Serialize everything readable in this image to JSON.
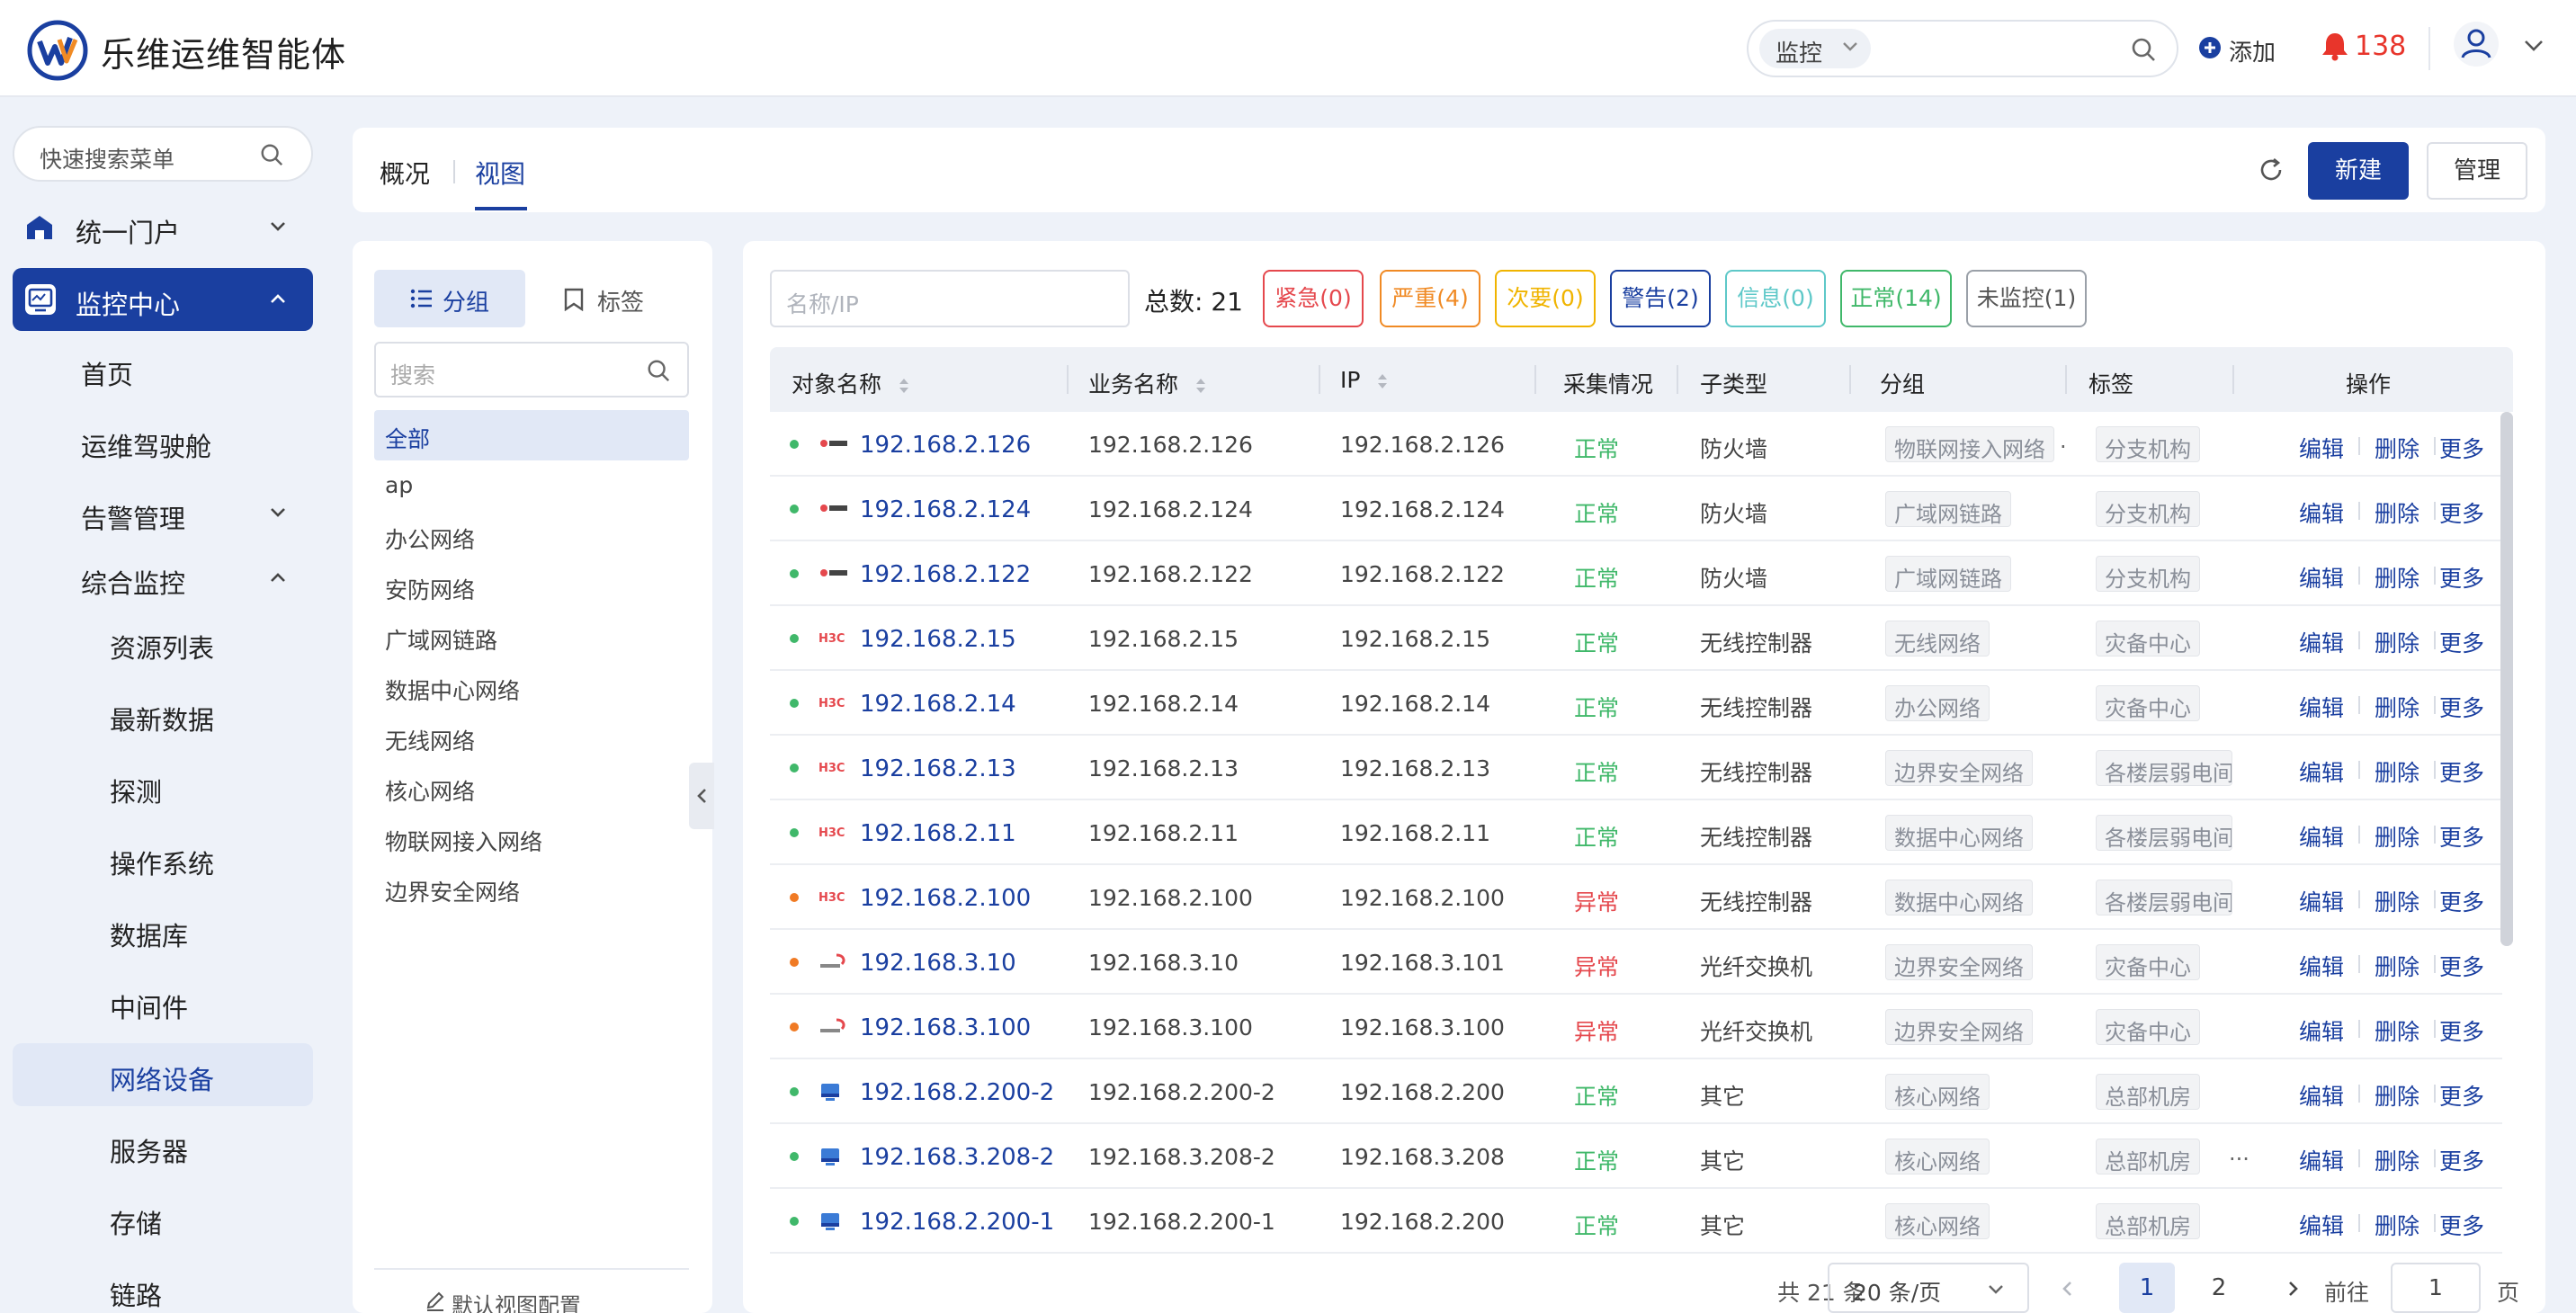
{
  "header": {
    "app_title": "乐维运维智能体",
    "search_scope": "监控",
    "add_label": "添加",
    "alert_count": "138"
  },
  "sidebar": {
    "search_placeholder": "快速搜索菜单",
    "portal": "统一门户",
    "monitor_center": "监控中心",
    "home": "首页",
    "cockpit": "运维驾驶舱",
    "alert_mgmt": "告警管理",
    "integrated": "综合监控",
    "resources": "资源列表",
    "latest": "最新数据",
    "probe": "探测",
    "os": "操作系统",
    "db": "数据库",
    "middleware": "中间件",
    "netdev": "网络设备",
    "server": "服务器",
    "storage": "存储",
    "link": "链路"
  },
  "top": {
    "tab_overview": "概况",
    "tab_view": "视图",
    "new_label": "新建",
    "manage_label": "管理"
  },
  "groups": {
    "tab_group": "分组",
    "tab_tag": "标签",
    "search_placeholder": "搜索",
    "items": [
      "全部",
      "ap",
      "办公网络",
      "安防网络",
      "广域网链路",
      "数据中心网络",
      "无线网络",
      "核心网络",
      "物联网接入网络",
      "边界安全网络"
    ],
    "footer": "默认视图配置"
  },
  "filter": {
    "placeholder": "名称/IP",
    "total_label": "总数:",
    "total": "21",
    "badges": {
      "urgent": "紧急(0)",
      "severe": "严重(4)",
      "minor": "次要(0)",
      "warning": "警告(2)",
      "info": "信息(0)",
      "normal": "正常(14)",
      "unmonitored": "未监控(1)"
    },
    "colors": {
      "urgent": "#e5484d",
      "severe": "#f08a24",
      "minor": "#f0b400",
      "warning": "#1a3fa0",
      "info": "#5ec8c8",
      "normal": "#40b86a",
      "unmonitored": "#9aa0a8"
    }
  },
  "table": {
    "columns": {
      "name": "对象名称",
      "biz": "业务名称",
      "ip": "IP",
      "collect": "采集情况",
      "subtype": "子类型",
      "group": "分组",
      "tag": "标签",
      "ops": "操作"
    },
    "actions": {
      "edit": "编辑",
      "delete": "删除",
      "more": "更多"
    },
    "rows": [
      {
        "vendor": "firewall-logo",
        "status": "ok",
        "name": "192.168.2.126",
        "biz": "192.168.2.126",
        "ip": "192.168.2.126",
        "collect": "正常",
        "subtype": "防火墙",
        "group": "物联网接入网络",
        "group_more": true,
        "tag": "分支机构",
        "tag_more": false
      },
      {
        "vendor": "firewall-logo",
        "status": "ok",
        "name": "192.168.2.124",
        "biz": "192.168.2.124",
        "ip": "192.168.2.124",
        "collect": "正常",
        "subtype": "防火墙",
        "group": "广域网链路",
        "group_more": false,
        "tag": "分支机构",
        "tag_more": false
      },
      {
        "vendor": "firewall-logo",
        "status": "ok",
        "name": "192.168.2.122",
        "biz": "192.168.2.122",
        "ip": "192.168.2.122",
        "collect": "正常",
        "subtype": "防火墙",
        "group": "广域网链路",
        "group_more": false,
        "tag": "分支机构",
        "tag_more": false
      },
      {
        "vendor": "h3c-logo",
        "status": "ok",
        "name": "192.168.2.15",
        "biz": "192.168.2.15",
        "ip": "192.168.2.15",
        "collect": "正常",
        "subtype": "无线控制器",
        "group": "无线网络",
        "group_more": false,
        "tag": "灾备中心",
        "tag_more": false
      },
      {
        "vendor": "h3c-logo",
        "status": "ok",
        "name": "192.168.2.14",
        "biz": "192.168.2.14",
        "ip": "192.168.2.14",
        "collect": "正常",
        "subtype": "无线控制器",
        "group": "办公网络",
        "group_more": false,
        "tag": "灾备中心",
        "tag_more": false
      },
      {
        "vendor": "h3c-logo",
        "status": "ok",
        "name": "192.168.2.13",
        "biz": "192.168.2.13",
        "ip": "192.168.2.13",
        "collect": "正常",
        "subtype": "无线控制器",
        "group": "边界安全网络",
        "group_more": false,
        "tag": "各楼层弱电间",
        "tag_more": false
      },
      {
        "vendor": "h3c-logo",
        "status": "ok",
        "name": "192.168.2.11",
        "biz": "192.168.2.11",
        "ip": "192.168.2.11",
        "collect": "正常",
        "subtype": "无线控制器",
        "group": "数据中心网络",
        "group_more": false,
        "tag": "各楼层弱电间",
        "tag_more": false
      },
      {
        "vendor": "h3c-logo",
        "status": "err",
        "name": "192.168.2.100",
        "biz": "192.168.2.100",
        "ip": "192.168.2.100",
        "collect": "异常",
        "subtype": "无线控制器",
        "group": "数据中心网络",
        "group_more": false,
        "tag": "各楼层弱电间",
        "tag_more": false
      },
      {
        "vendor": "brocade-logo",
        "status": "err",
        "name": "192.168.3.10",
        "biz": "192.168.3.10",
        "ip": "192.168.3.101",
        "collect": "异常",
        "subtype": "光纤交换机",
        "group": "边界安全网络",
        "group_more": false,
        "tag": "灾备中心",
        "tag_more": false
      },
      {
        "vendor": "brocade-logo",
        "status": "err",
        "name": "192.168.3.100",
        "biz": "192.168.3.100",
        "ip": "192.168.3.100",
        "collect": "异常",
        "subtype": "光纤交换机",
        "group": "边界安全网络",
        "group_more": false,
        "tag": "灾备中心",
        "tag_more": false
      },
      {
        "vendor": "device-icon",
        "status": "ok",
        "name": "192.168.2.200-2",
        "biz": "192.168.2.200-2",
        "ip": "192.168.2.200",
        "collect": "正常",
        "subtype": "其它",
        "group": "核心网络",
        "group_more": false,
        "tag": "总部机房",
        "tag_more": false
      },
      {
        "vendor": "device-icon",
        "status": "ok",
        "name": "192.168.3.208-2",
        "biz": "192.168.3.208-2",
        "ip": "192.168.3.208",
        "collect": "正常",
        "subtype": "其它",
        "group": "核心网络",
        "group_more": false,
        "tag": "总部机房",
        "tag_more": true
      },
      {
        "vendor": "device-icon",
        "status": "ok",
        "name": "192.168.2.200-1",
        "biz": "192.168.2.200-1",
        "ip": "192.168.2.200",
        "collect": "正常",
        "subtype": "其它",
        "group": "核心网络",
        "group_more": false,
        "tag": "总部机房",
        "tag_more": false
      }
    ]
  },
  "pager": {
    "total_text": "共 21 条",
    "page_size": "20 条/页",
    "page1": "1",
    "page2": "2",
    "goto": "前往",
    "goto_value": "1",
    "unit": "页"
  },
  "colors": {
    "brand": "#1a3fa0",
    "ok": "#40b86a",
    "err": "#e5484d",
    "alert": "#e8352b"
  }
}
